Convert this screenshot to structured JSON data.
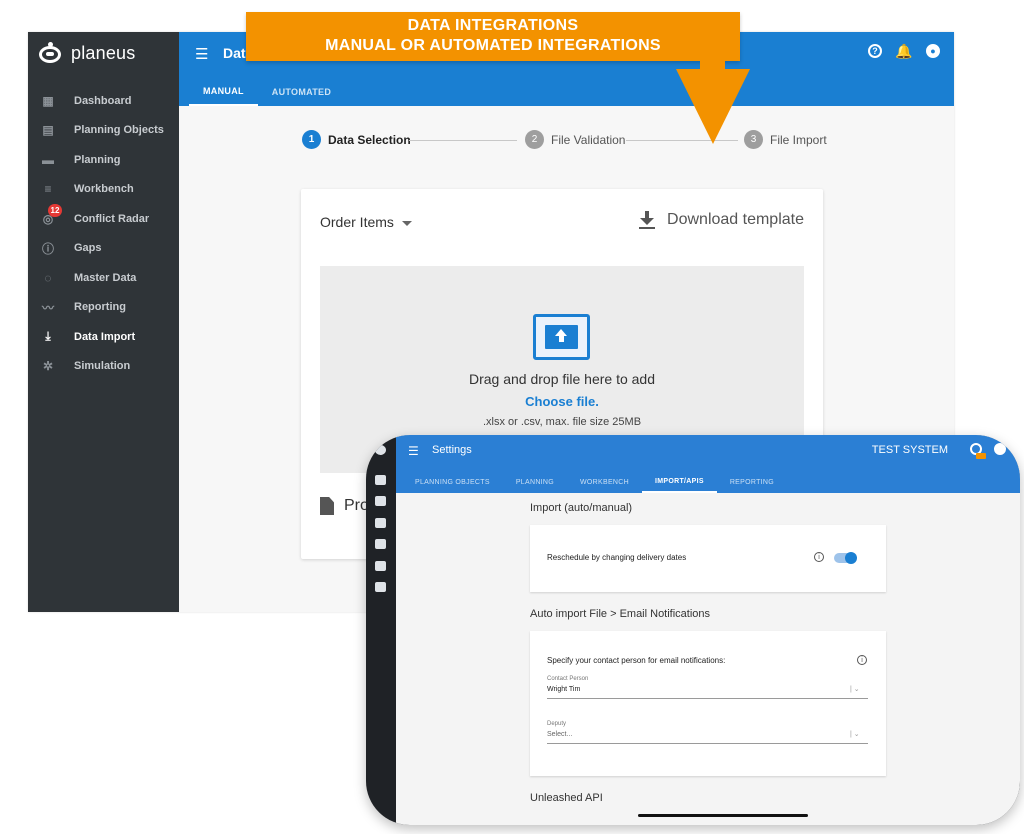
{
  "callout": {
    "line1": "DATA INTEGRATIONS",
    "line2": "MANUAL OR AUTOMATED INTEGRATIONS",
    "color": "#f39200"
  },
  "app": {
    "brand": "planeus",
    "title": "Data",
    "accent": "#1a7fd2",
    "sidebar_bg": "#2f3438",
    "nav": [
      {
        "label": "Dashboard",
        "icon": "dashboard-icon"
      },
      {
        "label": "Planning Objects",
        "icon": "planning-objects-icon"
      },
      {
        "label": "Planning",
        "icon": "planning-icon"
      },
      {
        "label": "Workbench",
        "icon": "workbench-icon"
      },
      {
        "label": "Conflict Radar",
        "icon": "radar-icon",
        "badge": "12"
      },
      {
        "label": "Gaps",
        "icon": "alert-icon"
      },
      {
        "label": "Master Data",
        "icon": "master-data-icon"
      },
      {
        "label": "Reporting",
        "icon": "reporting-icon"
      },
      {
        "label": "Data Import",
        "icon": "import-icon",
        "active": true
      },
      {
        "label": "Simulation",
        "icon": "simulation-icon"
      }
    ],
    "tabs": [
      {
        "label": "MANUAL",
        "active": true
      },
      {
        "label": "AUTOMATED",
        "active": false
      }
    ],
    "steps": [
      {
        "num": "1",
        "label": "Data Selection",
        "active": true
      },
      {
        "num": "2",
        "label": "File Validation",
        "active": false
      },
      {
        "num": "3",
        "label": "File Import",
        "active": false
      }
    ],
    "card": {
      "select_value": "Order Items",
      "download_label": "Download template",
      "drop_text": "Drag and drop file here to add",
      "choose_link": "Choose file.",
      "hint": ".xlsx or .csv, max. file size 25MB",
      "file_label": "Pro"
    }
  },
  "tablet": {
    "title": "Settings",
    "system": "TEST SYSTEM",
    "tabs": [
      {
        "label": "PLANNING OBJECTS",
        "active": false
      },
      {
        "label": "PLANNING",
        "active": false
      },
      {
        "label": "WORKBENCH",
        "active": false
      },
      {
        "label": "IMPORT/APIS",
        "active": true
      },
      {
        "label": "REPORTING",
        "active": false
      }
    ],
    "section1": "Import (auto/manual)",
    "reschedule_label": "Reschedule by changing delivery dates",
    "reschedule_enabled": true,
    "section2": "Auto import File > Email Notifications",
    "contact_prompt": "Specify your contact person for email notifications:",
    "contact_label": "Contact Person",
    "contact_value": "Wright Tim",
    "deputy_label": "Deputy",
    "deputy_placeholder": "Select...",
    "section3": "Unleashed API"
  }
}
